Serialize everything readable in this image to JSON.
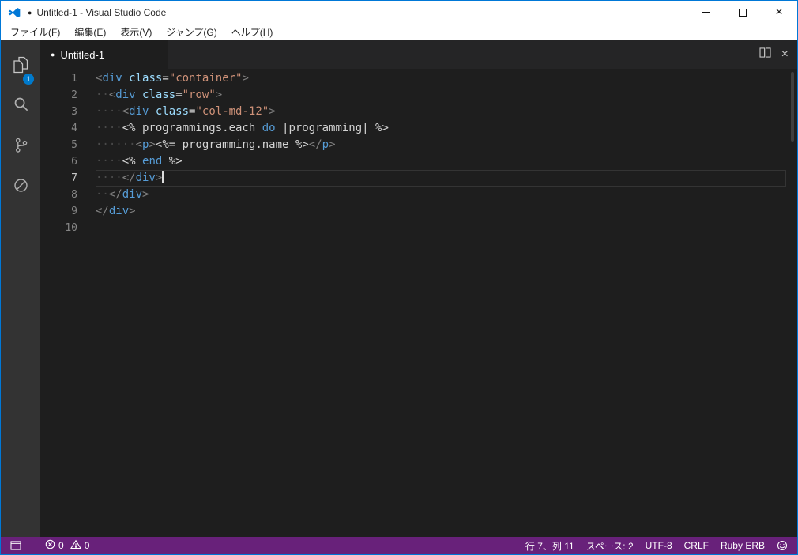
{
  "titlebar": {
    "modified_dot": "●",
    "title": "Untitled-1 - Visual Studio Code",
    "close_label": "×"
  },
  "menubar": {
    "items": [
      "ファイル(F)",
      "編集(E)",
      "表示(V)",
      "ジャンプ(G)",
      "ヘルプ(H)"
    ]
  },
  "activity_bar": {
    "explorer_badge": "1",
    "icons": [
      "explorer-icon",
      "search-icon",
      "source-control-icon",
      "debug-icon"
    ]
  },
  "tabbar": {
    "tab": {
      "modified_dot": "●",
      "label": "Untitled-1"
    },
    "close_label": "×"
  },
  "editor": {
    "language_hint": "Ruby ERB",
    "cursor_line": 7,
    "token_colors": {
      "punct": "#808080",
      "tag": "#569cd6",
      "attr": "#9cdcfe",
      "str": "#ce9178",
      "kw": "#569cd6",
      "plain": "#d4d4d4",
      "ws": "#4a4a4a"
    },
    "lines": [
      {
        "num": "1",
        "tokens": [
          [
            "<",
            "punct"
          ],
          [
            "div",
            "tag"
          ],
          [
            " ",
            "plain"
          ],
          [
            "class",
            "attr"
          ],
          [
            "=",
            "plain"
          ],
          [
            "\"container\"",
            "str"
          ],
          [
            ">",
            "punct"
          ]
        ]
      },
      {
        "num": "2",
        "tokens": [
          [
            "··",
            "ws"
          ],
          [
            "<",
            "punct"
          ],
          [
            "div",
            "tag"
          ],
          [
            " ",
            "plain"
          ],
          [
            "class",
            "attr"
          ],
          [
            "=",
            "plain"
          ],
          [
            "\"row\"",
            "str"
          ],
          [
            ">",
            "punct"
          ]
        ]
      },
      {
        "num": "3",
        "tokens": [
          [
            "····",
            "ws"
          ],
          [
            "<",
            "punct"
          ],
          [
            "div",
            "tag"
          ],
          [
            " ",
            "plain"
          ],
          [
            "class",
            "attr"
          ],
          [
            "=",
            "plain"
          ],
          [
            "\"col-md-12\"",
            "str"
          ],
          [
            ">",
            "punct"
          ]
        ]
      },
      {
        "num": "4",
        "tokens": [
          [
            "····",
            "ws"
          ],
          [
            "<% programmings.each ",
            "plain"
          ],
          [
            "do",
            "kw"
          ],
          [
            " |programming| %>",
            "plain"
          ]
        ]
      },
      {
        "num": "5",
        "tokens": [
          [
            "······",
            "ws"
          ],
          [
            "<",
            "punct"
          ],
          [
            "p",
            "tag"
          ],
          [
            ">",
            "punct"
          ],
          [
            "<%= programming.name %>",
            "plain"
          ],
          [
            "</",
            "punct"
          ],
          [
            "p",
            "tag"
          ],
          [
            ">",
            "punct"
          ]
        ]
      },
      {
        "num": "6",
        "tokens": [
          [
            "····",
            "ws"
          ],
          [
            "<% ",
            "plain"
          ],
          [
            "end",
            "kw"
          ],
          [
            " %>",
            "plain"
          ]
        ]
      },
      {
        "num": "7",
        "current": true,
        "cursor": true,
        "tokens": [
          [
            "····",
            "ws"
          ],
          [
            "</",
            "punct"
          ],
          [
            "div",
            "tag"
          ],
          [
            ">",
            "punct"
          ]
        ]
      },
      {
        "num": "8",
        "tokens": [
          [
            "··",
            "ws"
          ],
          [
            "</",
            "punct"
          ],
          [
            "div",
            "tag"
          ],
          [
            ">",
            "punct"
          ]
        ]
      },
      {
        "num": "9",
        "tokens": [
          [
            "</",
            "punct"
          ],
          [
            "div",
            "tag"
          ],
          [
            ">",
            "punct"
          ]
        ]
      },
      {
        "num": "10",
        "tokens": []
      }
    ]
  },
  "statusbar": {
    "errors": "0",
    "warnings": "0",
    "cursor_position": "行 7、列 11",
    "indentation": "スペース: 2",
    "encoding": "UTF-8",
    "eol": "CRLF",
    "language": "Ruby ERB"
  },
  "colors": {
    "window_border": "#0078d7",
    "titlebar_bg": "#ffffff",
    "activitybar_bg": "#333333",
    "tabbar_bg": "#252526",
    "editor_bg": "#1e1e1e",
    "statusbar_bg": "#68217a",
    "badge_bg": "#007acc"
  }
}
